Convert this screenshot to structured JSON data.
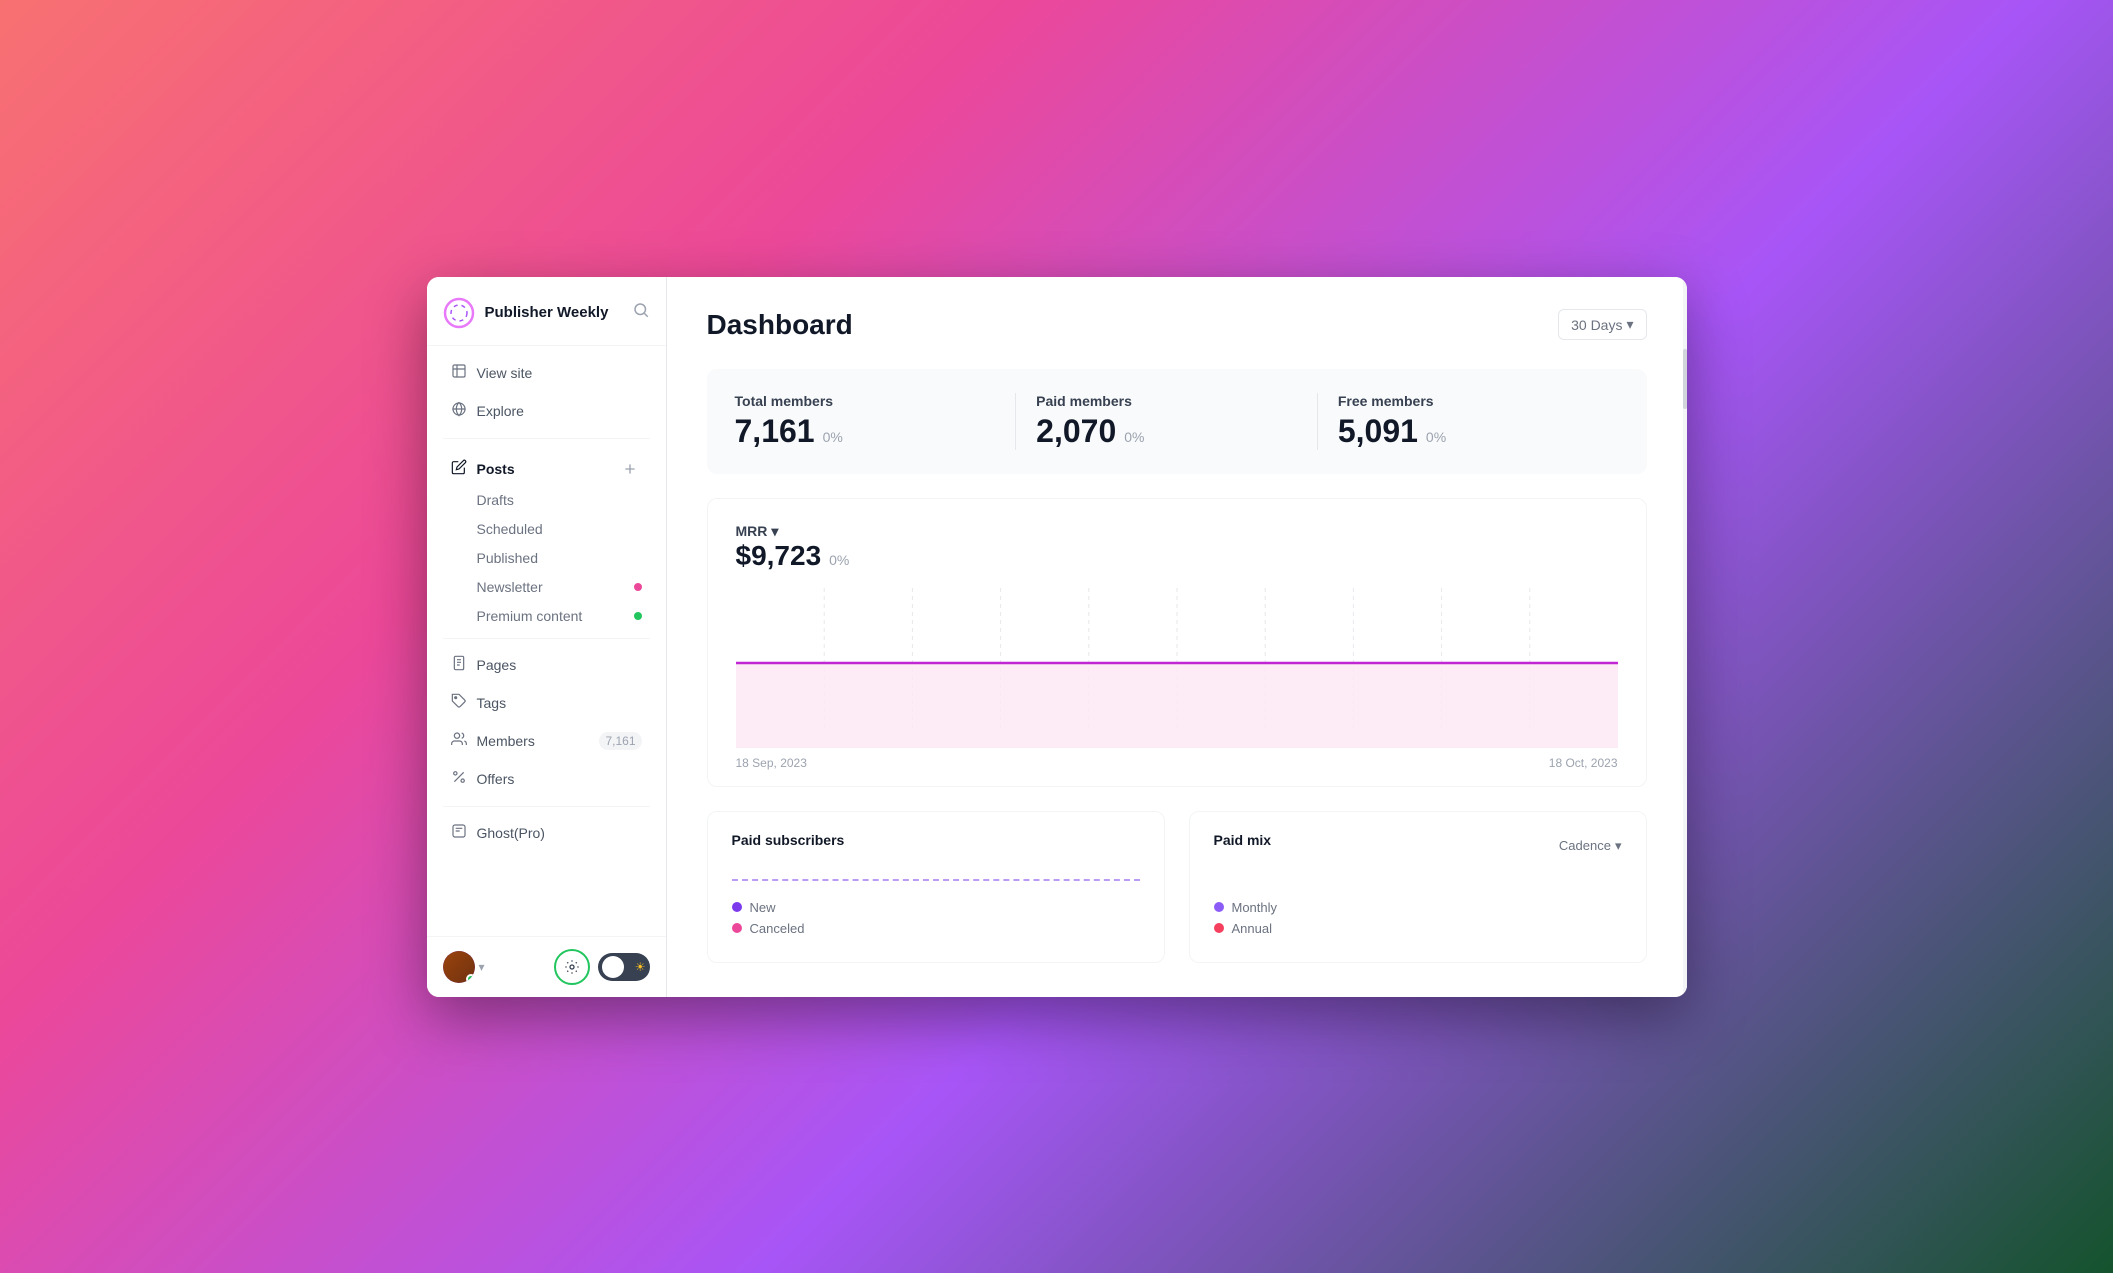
{
  "app": {
    "title": "Publisher Weekly"
  },
  "sidebar": {
    "logo_alt": "Publisher Weekly logo",
    "title": "Publisher Weekly",
    "nav": {
      "view_site": "View site",
      "explore": "Explore"
    },
    "posts": {
      "label": "Posts",
      "add_btn": "+",
      "sub_items": [
        {
          "label": "Drafts",
          "badge": null,
          "dot": null
        },
        {
          "label": "Scheduled",
          "badge": null,
          "dot": null
        },
        {
          "label": "Published",
          "badge": null,
          "dot": null
        },
        {
          "label": "Newsletter",
          "badge": null,
          "dot": "pink"
        },
        {
          "label": "Premium content",
          "badge": null,
          "dot": "green"
        }
      ]
    },
    "pages": "Pages",
    "tags": "Tags",
    "members": {
      "label": "Members",
      "count": "7,161"
    },
    "offers": "Offers",
    "ghost_pro": "Ghost(Pro)"
  },
  "header": {
    "title": "Dashboard",
    "period": {
      "label": "30 Days",
      "chevron": "▾"
    }
  },
  "stats": {
    "total_members": {
      "label": "Total members",
      "value": "7,161",
      "change": "0%"
    },
    "paid_members": {
      "label": "Paid members",
      "value": "2,070",
      "change": "0%"
    },
    "free_members": {
      "label": "Free members",
      "value": "5,091",
      "change": "0%"
    }
  },
  "mrr": {
    "title": "MRR",
    "chevron": "▾",
    "value": "$9,723",
    "change": "0%",
    "date_start": "18 Sep, 2023",
    "date_end": "18 Oct, 2023",
    "chart": {
      "accent_color": "#c026d3",
      "fill_color": "#fce7f3"
    }
  },
  "paid_subscribers": {
    "title": "Paid subscribers",
    "legend": [
      {
        "label": "New",
        "color": "purple"
      },
      {
        "label": "Canceled",
        "color": "pink"
      }
    ]
  },
  "paid_mix": {
    "title": "Paid mix",
    "cadence_label": "Cadence",
    "legend": [
      {
        "label": "Monthly",
        "color": "violet"
      },
      {
        "label": "Annual",
        "color": "rose"
      }
    ]
  },
  "footer": {
    "settings_icon": "⚙",
    "toggle_sun": "☀"
  }
}
